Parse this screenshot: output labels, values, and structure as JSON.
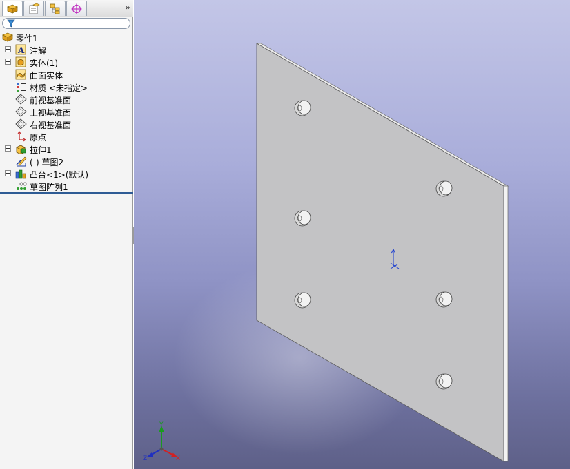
{
  "panel": {
    "tabs": [
      {
        "icon": "featuremanager-tree-icon",
        "active": true
      },
      {
        "icon": "propertymanager-icon",
        "active": false
      },
      {
        "icon": "configurationmanager-icon",
        "active": false
      },
      {
        "icon": "dimxpert-manager-icon",
        "active": false
      }
    ],
    "more": "»",
    "filter": {
      "icon": "filter-icon",
      "placeholder": ""
    },
    "tree": {
      "root": {
        "label": "零件1",
        "icon": "part-icon"
      },
      "items": [
        {
          "label": "注解",
          "icon": "annotations-icon",
          "expandable": true
        },
        {
          "label": "实体(1)",
          "icon": "solid-bodies-icon",
          "expandable": true
        },
        {
          "label": "曲面实体",
          "icon": "surface-bodies-icon",
          "expandable": false
        },
        {
          "label": "材质 <未指定>",
          "icon": "material-icon",
          "expandable": false
        },
        {
          "label": "前视基准面",
          "icon": "plane-icon",
          "expandable": false
        },
        {
          "label": "上视基准面",
          "icon": "plane-icon",
          "expandable": false
        },
        {
          "label": "右视基准面",
          "icon": "plane-icon",
          "expandable": false
        },
        {
          "label": "原点",
          "icon": "origin-icon",
          "expandable": false
        },
        {
          "label": "拉伸1",
          "icon": "extrude-icon",
          "expandable": true
        },
        {
          "label": "(-) 草图2",
          "icon": "sketch-icon",
          "expandable": false
        },
        {
          "label": "凸台<1>(默认)",
          "icon": "boss-library-feature-icon",
          "expandable": true
        },
        {
          "label": "草图阵列1",
          "icon": "sketch-pattern-icon",
          "expandable": false
        }
      ]
    }
  },
  "view": {
    "triad": {
      "x_label": "X",
      "y_label": "Y",
      "z_label": "Z"
    },
    "bosses_count": 6,
    "colors": {
      "plate_face": "#c2c2c4",
      "plate_edge": "#e9e9e9",
      "origin_marker": "#1a3cd0",
      "axis_x": "#d42020",
      "axis_y": "#1a9a20",
      "axis_z": "#2030c0"
    }
  }
}
